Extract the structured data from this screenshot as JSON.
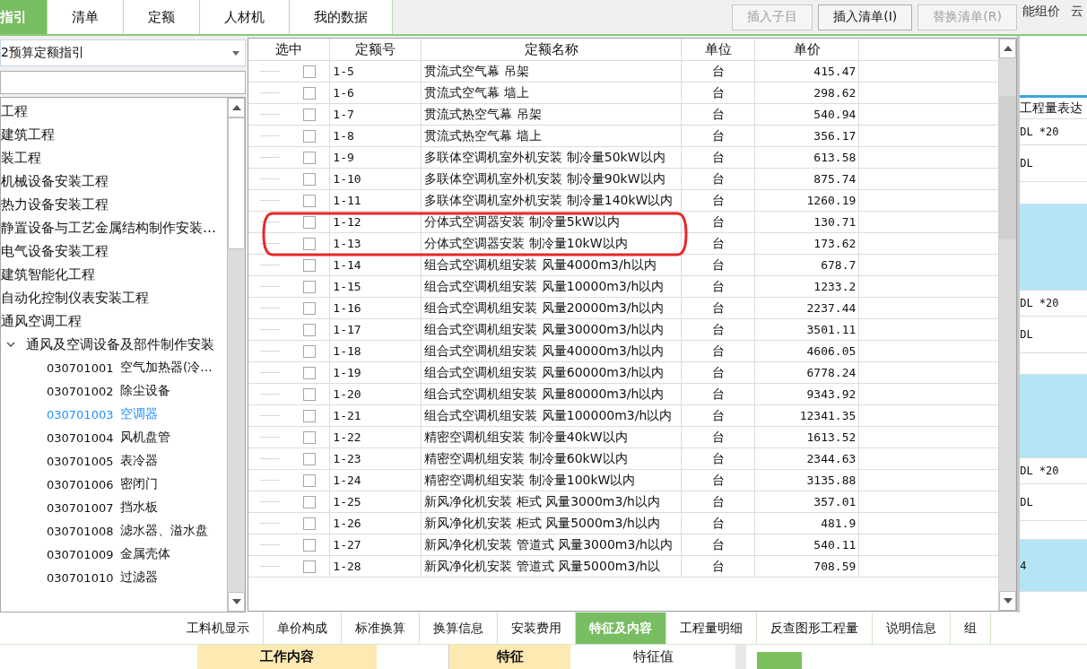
{
  "tabs": [
    {
      "label": "指引",
      "selected": true
    },
    {
      "label": "清单",
      "selected": false
    },
    {
      "label": "定额",
      "selected": false
    },
    {
      "label": "人材机",
      "selected": false
    },
    {
      "label": "我的数据",
      "selected": false
    }
  ],
  "toolbar_buttons": [
    {
      "label": "插入子目",
      "disabled": true
    },
    {
      "label": "插入清单(I)",
      "disabled": false
    },
    {
      "label": "替换清单(R)",
      "disabled": true
    }
  ],
  "side_menu": [
    "能组价",
    "云"
  ],
  "guide_select": {
    "value": "2预算定额指引"
  },
  "tree": [
    {
      "label": "工程"
    },
    {
      "label": "建筑工程"
    },
    {
      "label": "装工程"
    },
    {
      "label": "机械设备安装工程"
    },
    {
      "label": "热力设备安装工程"
    },
    {
      "label": "静置设备与工艺金属结构制作安装…"
    },
    {
      "label": "电气设备安装工程"
    },
    {
      "label": "建筑智能化工程"
    },
    {
      "label": "自动化控制仪表安装工程"
    },
    {
      "label": "通风空调工程",
      "children": [
        {
          "label": "通风及空调设备及部件制作安装",
          "expanded": true,
          "children": [
            {
              "code": "030701001",
              "label": "空气加热器(冷…",
              "selected": false
            },
            {
              "code": "030701002",
              "label": "除尘设备",
              "selected": false
            },
            {
              "code": "030701003",
              "label": "空调器",
              "selected": true
            },
            {
              "code": "030701004",
              "label": "风机盘管",
              "selected": false
            },
            {
              "code": "030701005",
              "label": "表冷器",
              "selected": false
            },
            {
              "code": "030701006",
              "label": "密闭门",
              "selected": false
            },
            {
              "code": "030701007",
              "label": "挡水板",
              "selected": false
            },
            {
              "code": "030701008",
              "label": "滤水器、溢水盘",
              "selected": false
            },
            {
              "code": "030701009",
              "label": "金属壳体",
              "selected": false
            },
            {
              "code": "030701010",
              "label": "过滤器",
              "selected": false
            }
          ]
        }
      ]
    }
  ],
  "table": {
    "columns": [
      "选中",
      "定额号",
      "定额名称",
      "单位",
      "单价"
    ],
    "rows": [
      {
        "checked": false,
        "circled": false,
        "code": "1-5",
        "name": "贯流式空气幕 吊架",
        "unit": "台",
        "price": "415.47"
      },
      {
        "checked": false,
        "circled": false,
        "code": "1-6",
        "name": "贯流式空气幕 墙上",
        "unit": "台",
        "price": "298.62"
      },
      {
        "checked": false,
        "circled": false,
        "code": "1-7",
        "name": "贯流式热空气幕 吊架",
        "unit": "台",
        "price": "540.94"
      },
      {
        "checked": false,
        "circled": false,
        "code": "1-8",
        "name": "贯流式热空气幕 墙上",
        "unit": "台",
        "price": "356.17"
      },
      {
        "checked": false,
        "circled": false,
        "code": "1-9",
        "name": "多联体空调机室外机安装 制冷量50kW以内",
        "unit": "台",
        "price": "613.58"
      },
      {
        "checked": false,
        "circled": false,
        "code": "1-10",
        "name": "多联体空调机室外机安装 制冷量90kW以内",
        "unit": "台",
        "price": "875.74"
      },
      {
        "checked": false,
        "circled": false,
        "code": "1-11",
        "name": "多联体空调机室外机安装 制冷量140kW以内",
        "unit": "台",
        "price": "1260.19"
      },
      {
        "checked": false,
        "circled": true,
        "code": "1-12",
        "name": "分体式空调器安装 制冷量5kW以内",
        "unit": "台",
        "price": "130.71"
      },
      {
        "checked": false,
        "circled": true,
        "code": "1-13",
        "name": "分体式空调器安装 制冷量10kW以内",
        "unit": "台",
        "price": "173.62"
      },
      {
        "checked": false,
        "circled": false,
        "code": "1-14",
        "name": "组合式空调机组安装 风量4000m3/h以内",
        "unit": "台",
        "price": "678.7"
      },
      {
        "checked": false,
        "circled": false,
        "code": "1-15",
        "name": "组合式空调机组安装 风量10000m3/h以内",
        "unit": "台",
        "price": "1233.2"
      },
      {
        "checked": false,
        "circled": false,
        "code": "1-16",
        "name": "组合式空调机组安装 风量20000m3/h以内",
        "unit": "台",
        "price": "2237.44"
      },
      {
        "checked": false,
        "circled": false,
        "code": "1-17",
        "name": "组合式空调机组安装 风量30000m3/h以内",
        "unit": "台",
        "price": "3501.11"
      },
      {
        "checked": false,
        "circled": false,
        "code": "1-18",
        "name": "组合式空调机组安装 风量40000m3/h以内",
        "unit": "台",
        "price": "4606.05"
      },
      {
        "checked": false,
        "circled": false,
        "code": "1-19",
        "name": "组合式空调机组安装 风量60000m3/h以内",
        "unit": "台",
        "price": "6778.24"
      },
      {
        "checked": false,
        "circled": false,
        "code": "1-20",
        "name": "组合式空调机组安装 风量80000m3/h以内",
        "unit": "台",
        "price": "9343.92"
      },
      {
        "checked": false,
        "circled": false,
        "code": "1-21",
        "name": "组合式空调机组安装 风量100000m3/h以内",
        "unit": "台",
        "price": "12341.35"
      },
      {
        "checked": false,
        "circled": false,
        "code": "1-22",
        "name": "精密空调机组安装 制冷量40kW以内",
        "unit": "台",
        "price": "1613.52"
      },
      {
        "checked": false,
        "circled": false,
        "code": "1-23",
        "name": "精密空调机组安装 制冷量60kW以内",
        "unit": "台",
        "price": "2344.63"
      },
      {
        "checked": false,
        "circled": false,
        "code": "1-24",
        "name": "精密空调机组安装 制冷量100kW以内",
        "unit": "台",
        "price": "3135.88"
      },
      {
        "checked": false,
        "circled": false,
        "code": "1-25",
        "name": "新风净化机安装 柜式 风量3000m3/h以内",
        "unit": "台",
        "price": "357.01"
      },
      {
        "checked": false,
        "circled": false,
        "code": "1-26",
        "name": "新风净化机安装 柜式 风量5000m3/h以内",
        "unit": "台",
        "price": "481.9"
      },
      {
        "checked": false,
        "circled": false,
        "code": "1-27",
        "name": "新风净化机安装 管道式 风量3000m3/h以内",
        "unit": "台",
        "price": "540.11"
      },
      {
        "checked": false,
        "circled": false,
        "code": "1-28",
        "name": "新风净化机安装 管道式 风量5000m3/h以",
        "unit": "台",
        "price": "708.59"
      }
    ]
  },
  "quantity_panel": {
    "header": "工程量表达",
    "rows": [
      {
        "text": "DL *20",
        "selected": false
      },
      {
        "text": "DL",
        "selected": false
      },
      {
        "selected": false
      },
      {
        "selected": true
      },
      {
        "text": "DL *20",
        "selected": false
      },
      {
        "text": "DL",
        "selected": false
      },
      {
        "selected": false
      },
      {
        "selected": true
      },
      {
        "text": "DL *20",
        "selected": false
      },
      {
        "text": "DL",
        "selected": false
      },
      {
        "selected": false
      },
      {
        "text": "4",
        "selected": true
      }
    ]
  },
  "bottom_tabs": [
    {
      "label": "工料机显示",
      "selected": false
    },
    {
      "label": "单价构成",
      "selected": false
    },
    {
      "label": "标准换算",
      "selected": false
    },
    {
      "label": "换算信息",
      "selected": false
    },
    {
      "label": "安装费用",
      "selected": false
    },
    {
      "label": "特征及内容",
      "selected": true
    },
    {
      "label": "工程量明细",
      "selected": false
    },
    {
      "label": "反查图形工程量",
      "selected": false
    },
    {
      "label": "说明信息",
      "selected": false
    },
    {
      "label": "组",
      "selected": false
    }
  ],
  "detail_headers": {
    "work_content": "工作内容",
    "feature": "特征",
    "feature_value": "特征值"
  }
}
